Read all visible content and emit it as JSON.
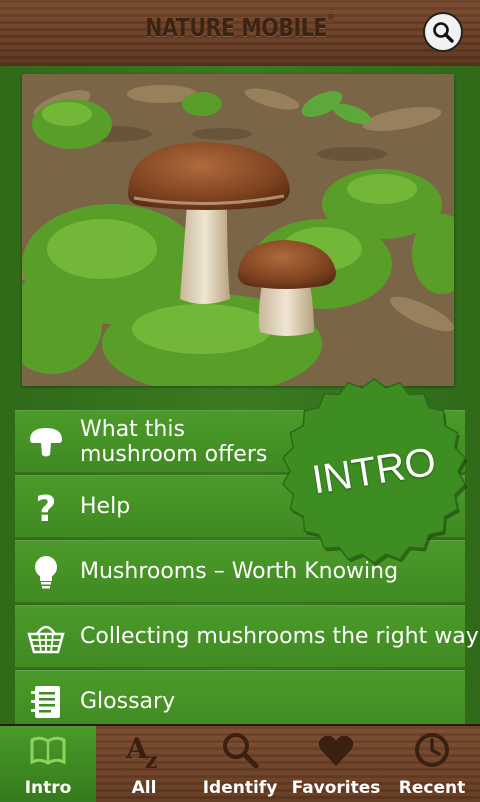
{
  "header": {
    "brand": "NATURE MOBILE",
    "brand_mark": "®"
  },
  "badge": {
    "label": "INTRO",
    "color": "#3d8d22"
  },
  "menu": {
    "items": [
      {
        "label": "What this mushroom offers",
        "icon": "mushroom-icon"
      },
      {
        "label": "Help",
        "icon": "question-icon"
      },
      {
        "label": "Mushrooms – Worth Knowing",
        "icon": "lightbulb-icon"
      },
      {
        "label": "Collecting mushrooms the right way",
        "icon": "basket-icon"
      },
      {
        "label": "Glossary",
        "icon": "notebook-icon"
      }
    ]
  },
  "tabs": [
    {
      "label": "Intro",
      "icon": "book-icon",
      "active": true
    },
    {
      "label": "All",
      "icon": "az-icon"
    },
    {
      "label": "Identify",
      "icon": "magnifier-icon"
    },
    {
      "label": "Favorites",
      "icon": "heart-icon"
    },
    {
      "label": "Recent",
      "icon": "clock-icon"
    }
  ],
  "colors": {
    "wood": "#6b3f25",
    "green": "#3f8a22",
    "active_tab": "#4a9a2a"
  }
}
